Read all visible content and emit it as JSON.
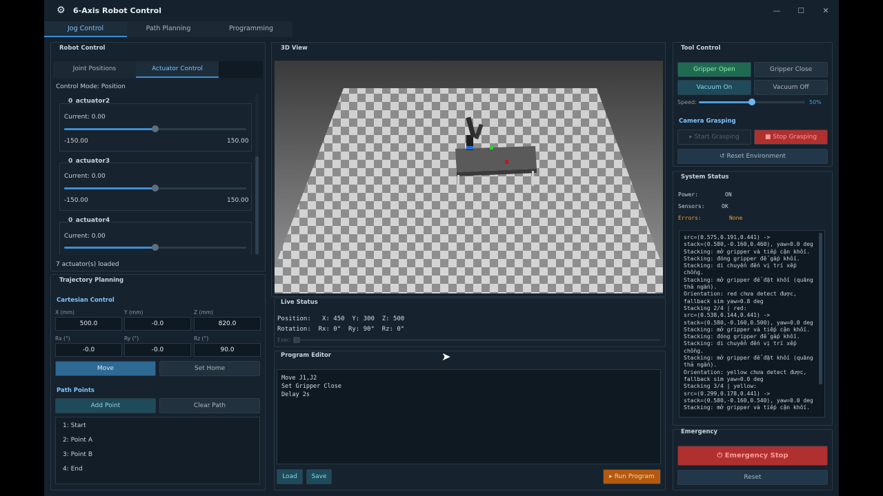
{
  "window": {
    "title": "6-Axis Robot Control",
    "controls": [
      "—",
      "☐",
      "✕"
    ]
  },
  "top_tabs": [
    {
      "label": "Jog Control",
      "active": true
    },
    {
      "label": "Path Planning",
      "active": false
    },
    {
      "label": "Programming",
      "active": false
    }
  ],
  "robot_control": {
    "title": "Robot Control",
    "tabs": [
      {
        "label": "Joint Positions",
        "active": false
      },
      {
        "label": "Actuator Control",
        "active": true
      }
    ],
    "control_mode": "Control Mode:  Position",
    "actuators": [
      {
        "name": "0_actuator2",
        "current": "Current:  0.00",
        "min": "-150.00",
        "max": "150.00",
        "value_fraction": 0.5
      },
      {
        "name": "0_actuator3",
        "current": "Current:  0.00",
        "min": "-150.00",
        "max": "150.00",
        "value_fraction": 0.5
      },
      {
        "name": "0_actuator4",
        "current": "Current:  0.00",
        "value_fraction": 0.5
      }
    ],
    "loaded": "7 actuator(s) loaded"
  },
  "trajectory": {
    "title": "Trajectory Planning",
    "cartesian_title": "Cartesian Control",
    "fields": [
      {
        "label": "X (mm)",
        "value": "500.0"
      },
      {
        "label": "Y (mm)",
        "value": "-0.0"
      },
      {
        "label": "Z (mm)",
        "value": "820.0"
      },
      {
        "label": "Rx (°)",
        "value": "-0.0"
      },
      {
        "label": "Ry (°)",
        "value": "-0.0"
      },
      {
        "label": "Rz (°)",
        "value": "90.0"
      }
    ],
    "move": "Move",
    "set_home": "Set Home",
    "path_points_title": "Path Points",
    "add_point": "Add Point",
    "clear_path": "Clear Path",
    "points": [
      "1:  Start",
      "2:  Point A",
      "3:  Point B",
      "4:  End"
    ]
  },
  "view3d": {
    "title": "3D View"
  },
  "live_status": {
    "title": "Live Status",
    "position": "Position:   X: 450  Y: 300  Z: 500",
    "rotation": "Rotation:  Rx: 0°  Ry: 90°  Rz: 0°",
    "exec_label": "Exec:"
  },
  "program_editor": {
    "title": "Program Editor",
    "lines": [
      "Move J1,J2",
      "Set Gripper Close",
      "Delay 2s"
    ],
    "load": "Load",
    "save": "Save",
    "run": "▸  Run Program"
  },
  "tool_control": {
    "title": "Tool Control",
    "gripper_open": "Gripper Open",
    "gripper_close": "Gripper Close",
    "vacuum_on": "Vacuum On",
    "vacuum_off": "Vacuum Off",
    "speed_label": "Speed:",
    "speed_value": "50%",
    "speed_fraction": 0.5,
    "camera_title": "Camera Grasping",
    "start_grasping": "▸  Start Grasping",
    "stop_grasping": "■  Stop Grasping",
    "reset_env": "↺  Reset Environment"
  },
  "system_status": {
    "title": "System Status",
    "power_label": "Power:",
    "power_value": "ON",
    "sensors_label": "Sensors:",
    "sensors_value": "OK",
    "errors_label": "Errors:",
    "errors_value": "None",
    "log": [
      "src=(0.575,0.191,0.441) ->",
      "stack=(0.580,-0.160,0.460), yaw=0.0 deg",
      "Stacking: mở gripper và tiếp cận khối.",
      "Stacking: đóng gripper để gắp khối.",
      "Stacking: di chuyển đến vị trí xếp",
      "chồng.",
      "Stacking: mở gripper để đặt khối (quãng",
      "thả ngắn).",
      "Orientation: red chưa detect được,",
      "fallback sim yaw=0.8 deg",
      "Stacking 2/4 | red:",
      "src=(0.538,0.144,0.441) ->",
      "stack=(0.580,-0.160,0.500), yaw=0.0 deg",
      "Stacking: mở gripper và tiếp cận khối.",
      "Stacking: đóng gripper để gắp khối.",
      "Stacking: di chuyển đến vị trí xếp",
      "chồng.",
      "Stacking: mở gripper để đặt khối (quãng",
      "thả ngắn).",
      "Orientation: yellow chưa detect được,",
      "fallback sim yaw=0.0 deg",
      "Stacking 3/4 | yellow:",
      "src=(0.299,0.178,0.441) ->",
      "stack=(0.580,-0.160,0.540), yaw=0.0 deg",
      "Stacking: mở gripper và tiếp cận khối."
    ]
  },
  "emergency": {
    "title": "Emergency",
    "stop": "⏻  Emergency Stop",
    "reset": "Reset"
  }
}
